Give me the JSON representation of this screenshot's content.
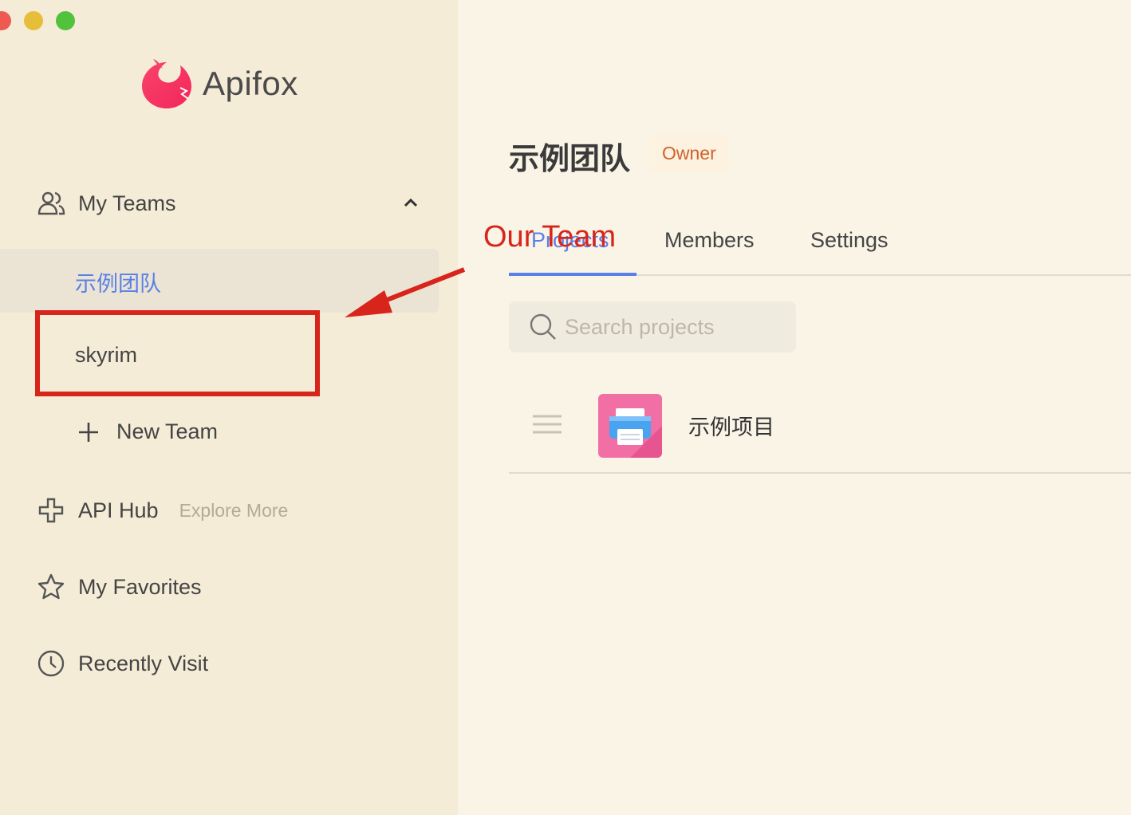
{
  "app": {
    "name": "Apifox"
  },
  "sidebar": {
    "my_teams_label": "My Teams",
    "teams": [
      {
        "name": "示例团队",
        "selected": true
      },
      {
        "name": "skyrim",
        "selected": false
      }
    ],
    "new_team_label": "New Team",
    "api_hub_label": "API Hub",
    "explore_more_label": "Explore More",
    "favorites_label": "My Favorites",
    "recent_label": "Recently Visit"
  },
  "main": {
    "team_title": "示例团队",
    "role_badge": "Owner",
    "tabs": [
      {
        "label": "Projects",
        "active": true
      },
      {
        "label": "Members",
        "active": false
      },
      {
        "label": "Settings",
        "active": false
      }
    ],
    "search": {
      "placeholder": "Search projects"
    },
    "projects": [
      {
        "name": "示例项目"
      }
    ]
  },
  "annotation": {
    "overlay_label": "Our Team"
  },
  "colors": {
    "accent": "#5a80e8",
    "annotation_red": "#d8251c",
    "owner_badge_text": "#d0632a",
    "sidebar_bg": "#f5ecd7",
    "main_bg": "#faf4e7"
  }
}
